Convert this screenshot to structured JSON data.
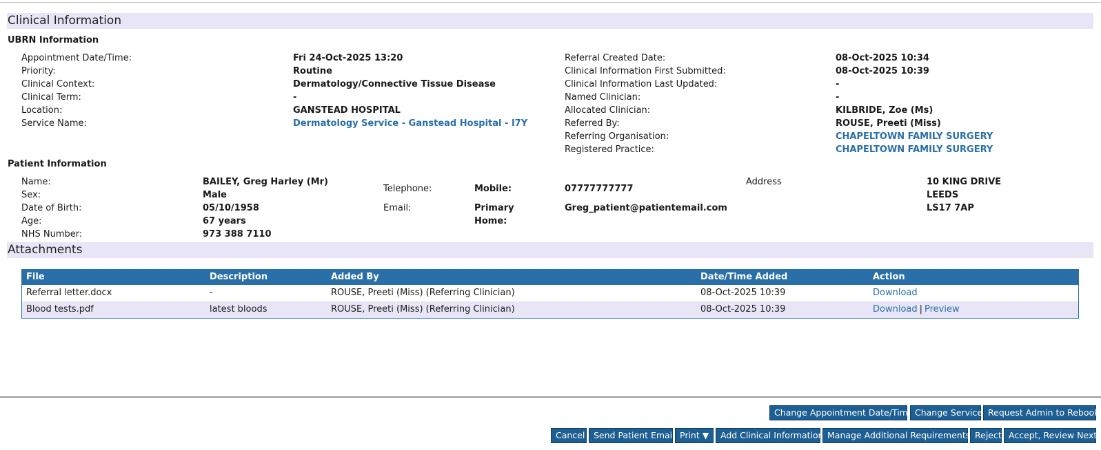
{
  "clinical": {
    "title": "Clinical Information",
    "ubrn_heading": "UBRN Information",
    "left_labels": [
      "Appointment Date/Time:",
      "Priority:",
      "Clinical Context:",
      "Clinical Term:",
      "Location:",
      "Service Name:"
    ],
    "left_values": [
      "Fri 24-Oct-2025 13:20",
      "Routine",
      "Dermatology/Connective Tissue Disease",
      "-",
      "GANSTEAD HOSPITAL",
      "Dermatology Service - Ganstead Hospital - I7Y"
    ],
    "right_labels": [
      "Referral Created Date:",
      "Clinical Information First Submitted:",
      "Clinical Information Last Updated:",
      "Named Clinician:",
      "Allocated Clinician:",
      "Referred By:",
      "Referring Organisation:",
      "Registered Practice:"
    ],
    "right_values": [
      "08-Oct-2025 10:34",
      "08-Oct-2025 10:39",
      "-",
      "-",
      "KILBRIDE, Zoe (Ms)",
      "ROUSE, Preeti (Miss)",
      "CHAPELTOWN FAMILY SURGERY",
      "CHAPELTOWN FAMILY SURGERY"
    ]
  },
  "patient": {
    "heading": "Patient Information",
    "labels": [
      "Name:",
      "Sex:",
      "Date of Birth:",
      "Age:",
      "NHS Number:"
    ],
    "values": [
      "BAILEY, Greg Harley (Mr)",
      "Male",
      "05/10/1958",
      "67 years",
      "973 388 7110"
    ],
    "telephone_label": "Telephone:",
    "mobile_label": "Mobile:",
    "mobile_value": "07777777777",
    "email_label": "Email:",
    "primary_label": "Primary",
    "primary_value": "Greg_patient@patientemail.com",
    "home_label": "Home:",
    "address_label": "Address",
    "address_lines": [
      "10 KING DRIVE",
      "LEEDS",
      "LS17 7AP"
    ]
  },
  "attachments": {
    "title": "Attachments",
    "columns": [
      "File",
      "Description",
      "Added By",
      "Date/Time Added",
      "Action"
    ],
    "rows": [
      {
        "file": "Referral letter.docx",
        "description": "-",
        "added_by": "ROUSE, Preeti (Miss) (Referring Clinician)",
        "date": "08-Oct-2025 10:39",
        "download": "Download",
        "preview": ""
      },
      {
        "file": "Blood tests.pdf",
        "description": "latest bloods",
        "added_by": "ROUSE, Preeti (Miss) (Referring Clinician)",
        "date": "08-Oct-2025 10:39",
        "download": "Download",
        "preview": "Preview"
      }
    ],
    "separator": "|"
  },
  "buttons": {
    "change_appointment": "Change Appointment Date/Time",
    "change_service": "Change Service",
    "request_admin": "Request Admin to Rebook",
    "cancel": "Cancel",
    "send_email": "Send Patient Email",
    "print": "Print ▼",
    "add_clinical": "Add Clinical Information",
    "manage_requirements": "Manage Additional Requirements",
    "reject": "Reject",
    "accept": "Accept, Review Next"
  }
}
